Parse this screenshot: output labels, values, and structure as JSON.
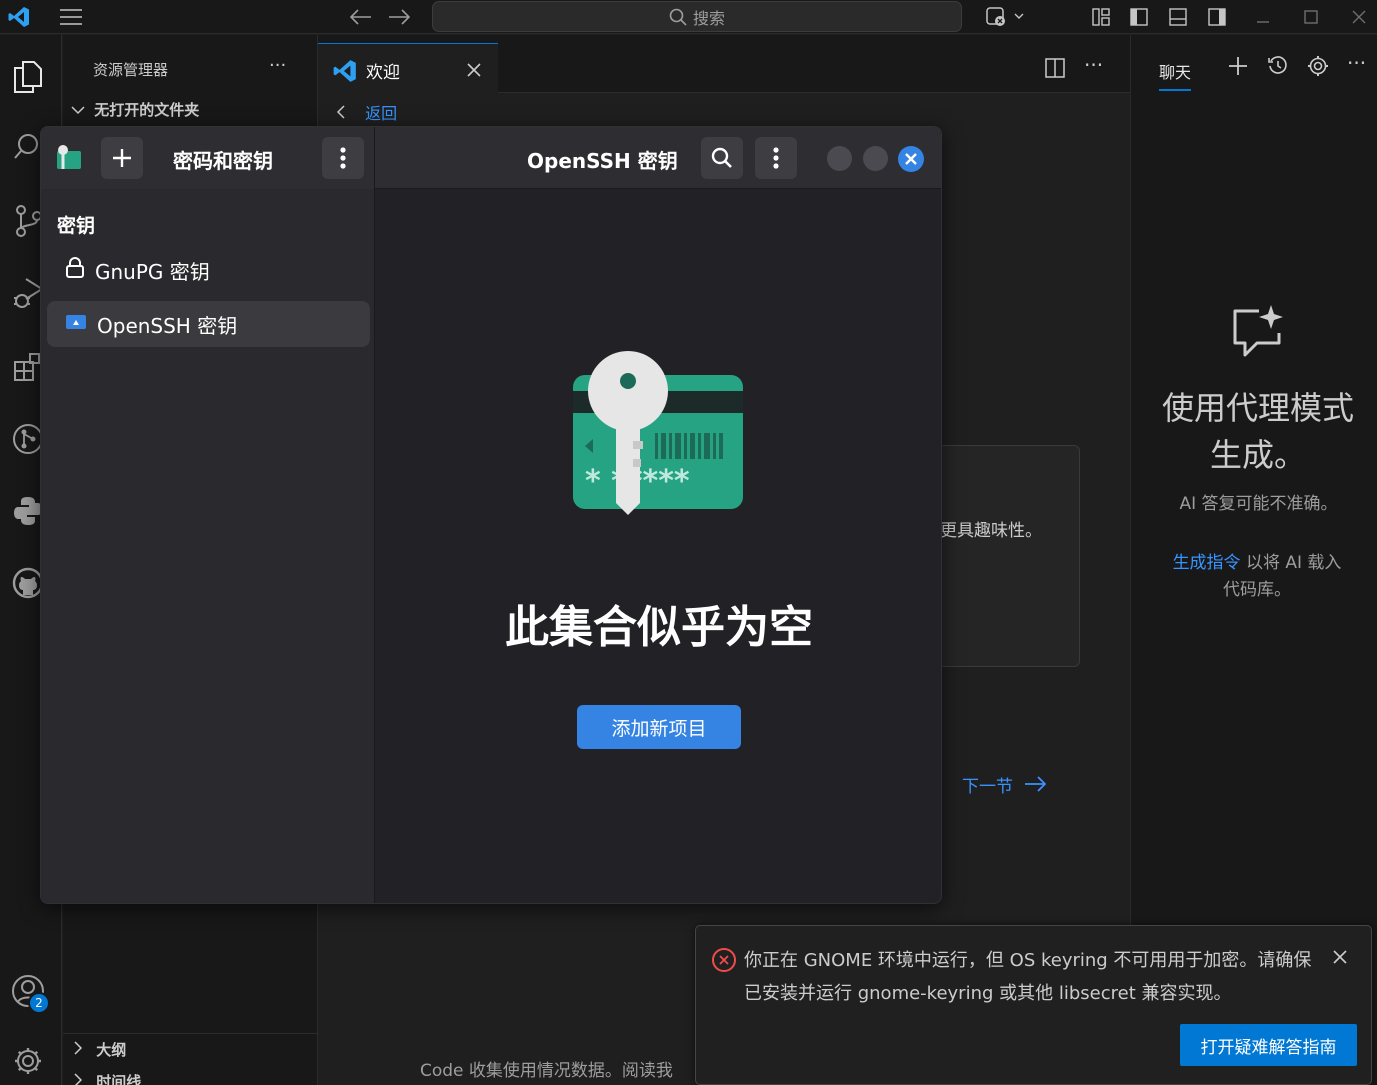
{
  "titlebar": {
    "search_placeholder": "搜索"
  },
  "sidebar": {
    "title": "资源管理器",
    "more": "···",
    "folder_header": "无打开的文件夹",
    "outline_label": "大纲",
    "timeline_label": "时间线"
  },
  "activity": {
    "accounts_badge": "2"
  },
  "editor": {
    "tab_label": "欢迎",
    "back_label": "返回",
    "card_text": "更具趣味性。",
    "next_section": "下一节",
    "telemetry": "Code 收集使用情况数据。阅读我"
  },
  "chat": {
    "tab_label": "聊天",
    "heading": "使用代理模式生成。",
    "note": "AI 答复可能不准确。",
    "link_text": "生成指令",
    "link_suffix": "以将 AI 载入代码库。"
  },
  "dialog": {
    "app_title": "密码和密钥",
    "collection_title": "OpenSSH 密钥",
    "section_label": "密钥",
    "items": [
      {
        "label": "GnuPG 密钥",
        "selected": false
      },
      {
        "label": "OpenSSH 密钥",
        "selected": true
      }
    ],
    "empty_title": "此集合似乎为空",
    "add_button": "添加新项目"
  },
  "notification": {
    "message": "你正在 GNOME 环境中运行，但 OS keyring 不可用用于加密。请确保已安装并运行 gnome-keyring 或其他 libsecret 兼容实现。",
    "action_button": "打开疑难解答指南"
  },
  "colors": {
    "accent": "#0078d4",
    "gnome_blue": "#3584e4",
    "error": "#f14c4c",
    "key_card": "#26a383"
  }
}
